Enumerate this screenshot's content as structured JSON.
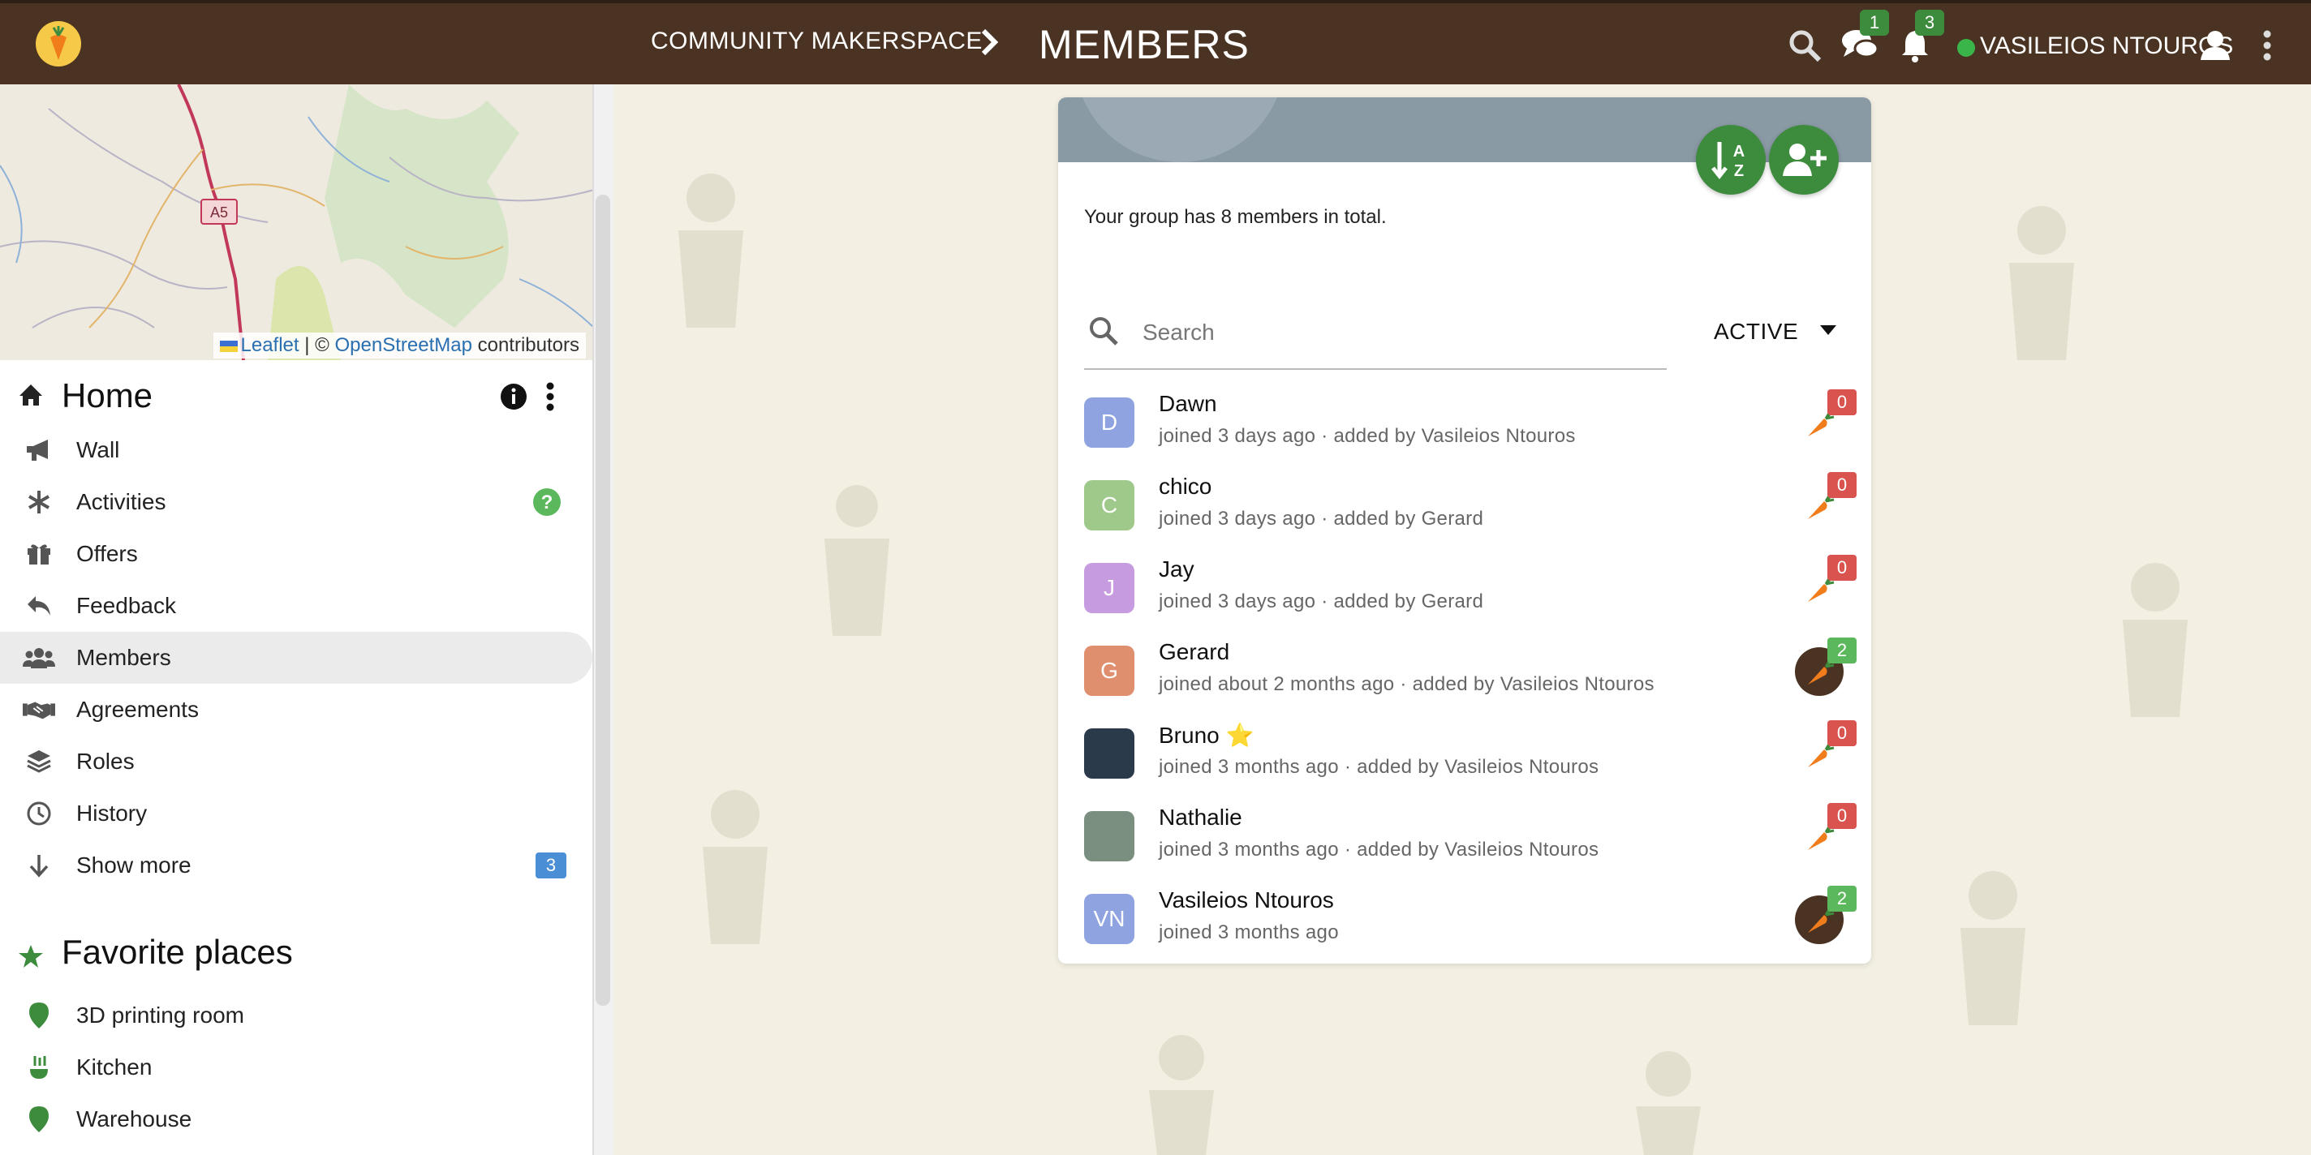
{
  "header": {
    "group_name": "COMMUNITY MAKERSPACE",
    "page_title": "MEMBERS",
    "messages_count": "1",
    "notifications_count": "3",
    "user_name": "VASILEIOS NTOUROS"
  },
  "map": {
    "road_label": "A5",
    "attr_leaflet": "Leaflet",
    "attr_sep": " | © ",
    "attr_osm": "OpenStreetMap",
    "attr_contrib": " contributors"
  },
  "sidebar": {
    "place_title": "Home",
    "items": [
      {
        "label": "Wall",
        "icon": "megaphone-icon"
      },
      {
        "label": "Activities",
        "icon": "asterisk-icon"
      },
      {
        "label": "Offers",
        "icon": "gift-icon"
      },
      {
        "label": "Feedback",
        "icon": "reply-icon"
      },
      {
        "label": "Members",
        "icon": "users-icon"
      },
      {
        "label": "Agreements",
        "icon": "handshake-icon"
      },
      {
        "label": "Roles",
        "icon": "layers-icon"
      },
      {
        "label": "History",
        "icon": "clock-icon"
      },
      {
        "label": "Show more",
        "icon": "arrow-down-icon",
        "badge": "3"
      }
    ],
    "favorites_title": "Favorite places",
    "favorites": [
      {
        "label": "3D printing room",
        "icon": "map-pin-icon"
      },
      {
        "label": "Kitchen",
        "icon": "kitchen-icon"
      },
      {
        "label": "Warehouse",
        "icon": "map-pin-icon"
      }
    ]
  },
  "main": {
    "total_text": "Your group has 8 members in total.",
    "search_placeholder": "Search",
    "filter_value": "ACTIVE",
    "members": [
      {
        "initials": "D",
        "name": "Dawn",
        "meta": "joined 3 days ago · added by Vasileios Ntouros",
        "karma": "0",
        "avatar_color": "#8fa3e0"
      },
      {
        "initials": "C",
        "name": "chico",
        "meta": "joined 3 days ago · added by Gerard",
        "karma": "0",
        "avatar_color": "#9ec98a"
      },
      {
        "initials": "J",
        "name": "Jay",
        "meta": "joined 3 days ago · added by Gerard",
        "karma": "0",
        "avatar_color": "#c69be0"
      },
      {
        "initials": "G",
        "name": "Gerard",
        "meta": "joined about 2 months ago · added by Vasileios Ntouros",
        "karma": "2",
        "avatar_color": "#e08f6e"
      },
      {
        "initials": "",
        "name": "Bruno ⭐",
        "meta": "joined 3 months ago · added by Vasileios Ntouros",
        "karma": "0",
        "avatar_color": "#2b3a4a"
      },
      {
        "initials": "",
        "name": "Nathalie",
        "meta": "joined 3 months ago · added by Vasileios Ntouros",
        "karma": "0",
        "avatar_color": "#7a8f80"
      },
      {
        "initials": "VN",
        "name": "Vasileios Ntouros",
        "meta": "joined 3 months ago",
        "karma": "2",
        "avatar_color": "#8fa3e0"
      }
    ]
  }
}
